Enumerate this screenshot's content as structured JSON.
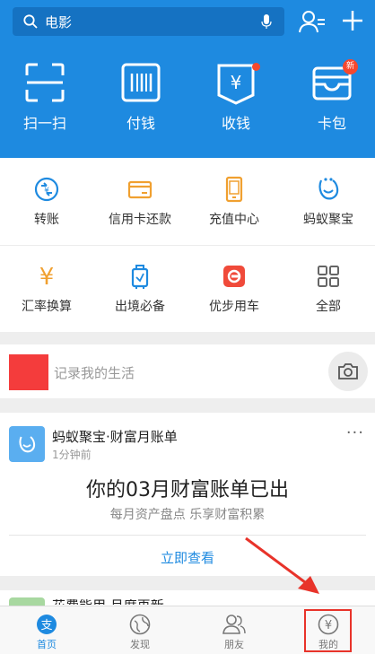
{
  "colors": {
    "header_bg": "#1e8ae0",
    "accent": "#1e8ae0",
    "badge_red": "#f5482e",
    "annotation_red": "#e8332a",
    "orange": "#f0a030"
  },
  "header": {
    "search_placeholder": "电影",
    "search_icon": "search-icon",
    "mic_icon": "microphone-icon",
    "contacts_icon": "contacts-icon",
    "add_icon": "plus-icon",
    "quick_actions": [
      {
        "label": "扫一扫",
        "icon": "scan-icon"
      },
      {
        "label": "付钱",
        "icon": "barcode-icon"
      },
      {
        "label": "收钱",
        "icon": "receive-money-icon"
      },
      {
        "label": "卡包",
        "icon": "card-wallet-icon",
        "badge": "新"
      }
    ]
  },
  "grid": {
    "items": [
      {
        "label": "转账",
        "icon": "transfer-icon"
      },
      {
        "label": "信用卡还款",
        "icon": "credit-card-icon"
      },
      {
        "label": "充值中心",
        "icon": "phone-recharge-icon"
      },
      {
        "label": "蚂蚁聚宝",
        "icon": "ant-fortune-icon"
      },
      {
        "label": "汇率换算",
        "icon": "exchange-rate-icon"
      },
      {
        "label": "出境必备",
        "icon": "luggage-icon"
      },
      {
        "label": "优步用车",
        "icon": "uber-icon"
      },
      {
        "label": "全部",
        "icon": "grid-all-icon"
      }
    ]
  },
  "record": {
    "placeholder": "记录我的生活",
    "camera_icon": "camera-icon"
  },
  "card": {
    "title": "蚂蚁聚宝·财富月账单",
    "time": "1分钟前",
    "more": "···",
    "headline": "你的03月财富账单已出",
    "subtitle": "每月资产盘点 乐享财富积累",
    "action": "立即查看"
  },
  "card2": {
    "title": "花费能用 月度再新"
  },
  "tabbar": {
    "tabs": [
      {
        "label": "首页",
        "icon": "home-alipay-icon",
        "active": true
      },
      {
        "label": "发现",
        "icon": "discover-icon",
        "active": false
      },
      {
        "label": "朋友",
        "icon": "friends-icon",
        "active": false
      },
      {
        "label": "我的",
        "icon": "my-wallet-icon",
        "active": false
      }
    ]
  }
}
